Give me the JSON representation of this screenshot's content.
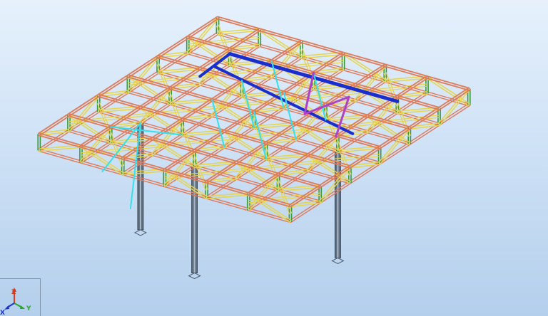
{
  "viewport": {
    "background_top": "#e6f1fc",
    "background_bottom": "#b4cfec"
  },
  "model": {
    "chord_color": "#e07a5a",
    "diagonal_color": "#e6d44a",
    "vertical_color": "#3a9a3a",
    "highlight_beam_color": "#1a2ecf",
    "highlight_brace_color": "#33e0ee",
    "highlight_brace_alt_color": "#b040c8",
    "column_color": "#5f6f80"
  },
  "triad": {
    "x_label": "X",
    "y_label": "Y",
    "z_label": "Z",
    "x_color": "#1a34d8",
    "y_color": "#2aa62a",
    "z_color": "#d83a1a"
  }
}
